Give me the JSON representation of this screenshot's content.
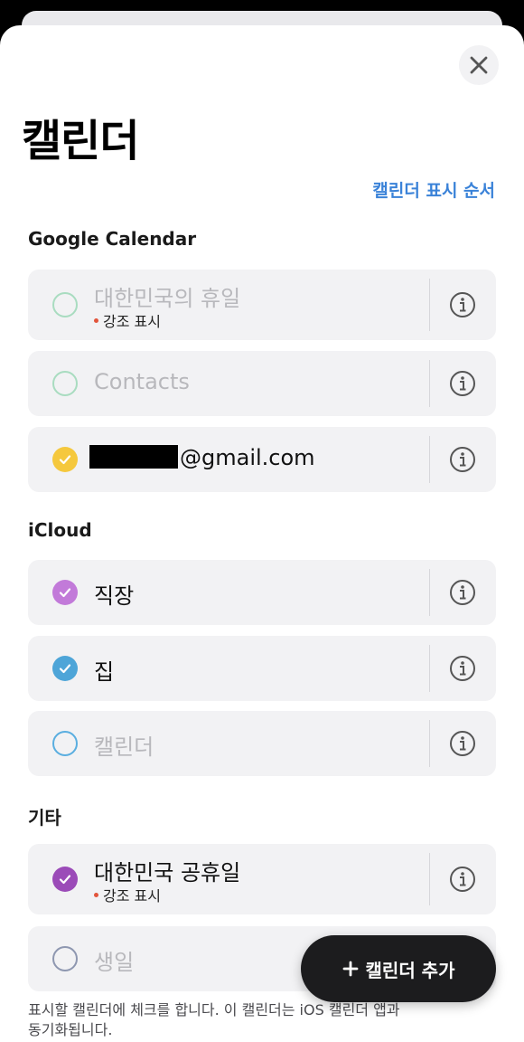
{
  "title": "캘린더",
  "order_link": "캘린더 표시 순서",
  "sections": {
    "google": "Google Calendar",
    "icloud": "iCloud",
    "other": "기타"
  },
  "rows": {
    "holiday_kr": {
      "label": "대한민국의 휴일",
      "sub": "강조 표시",
      "checked": false,
      "color": "#a9dcc0"
    },
    "contacts": {
      "label": "Contacts",
      "checked": false,
      "color": "#a9dcc0"
    },
    "gmail": {
      "label": "@gmail.com",
      "checked": true,
      "color": "#f5c83d"
    },
    "work": {
      "label": "직장",
      "checked": true,
      "color": "#c27ad9"
    },
    "home": {
      "label": "집",
      "checked": true,
      "color": "#4ea5d8"
    },
    "calendar": {
      "label": "캘린더",
      "checked": false,
      "color": "#5aaee0"
    },
    "public_holiday": {
      "label": "대한민국 공휴일",
      "sub": "강조 표시",
      "checked": true,
      "color": "#9b4bb8"
    },
    "birthday": {
      "label": "생일",
      "checked": false,
      "color": "#8e97b0"
    }
  },
  "footnote": "표시할 캘린더에 체크를 합니다. 이 캘린더는 iOS 캘린더 앱과 동기화됩니다.",
  "add_button": {
    "icon": "plus-icon",
    "label": "캘린더 추가"
  },
  "close_icon": "close-icon",
  "info_icon": "info-icon",
  "checkmark_icon": "checkmark-icon"
}
